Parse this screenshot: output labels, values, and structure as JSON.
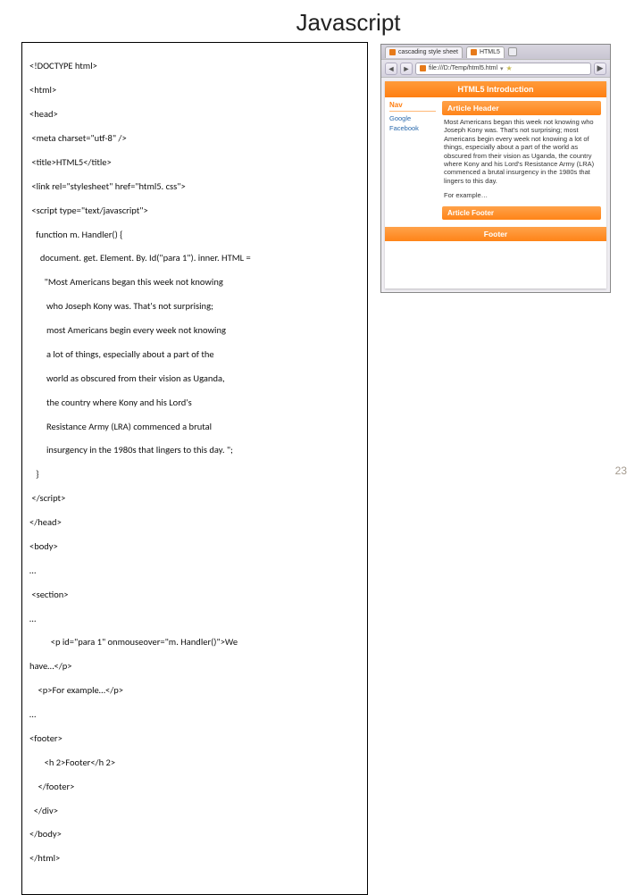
{
  "title": "Javascript",
  "slide_number": "23",
  "code": {
    "l1": "<!DOCTYPE html>",
    "l2": "<html>",
    "l3": "<head>",
    "l4": " <meta charset=\"utf-8\" />",
    "l5": " <title>HTML5</title>",
    "l6": " <link rel=\"stylesheet\" href=\"html5. css\">",
    "l7": " <script type=\"text/javascript\">",
    "l8": "   function m. Handler() {",
    "l9": "     document. get. Element. By. Id(\"para 1\"). inner. HTML =",
    "l10": "       \"Most Americans began this week not knowing",
    "l11": "        who Joseph Kony was. That's not surprising;",
    "l12": "        most Americans begin every week not knowing",
    "l13": "        a lot of things, especially about a part of the",
    "l14": "        world as obscured from their vision as Uganda,",
    "l15": "        the country where Kony and his Lord's",
    "l16": "        Resistance Army (LRA) commenced a brutal",
    "l17": "        insurgency in the 1980s that lingers to this day. \";",
    "l18": "   }",
    "l19": " </script>",
    "l20": "</head>",
    "l21": "<body>",
    "l22": "…",
    "l23": " <section>",
    "l24": "…",
    "l25": "          <p id=\"para 1\" onmouseover=\"m. Handler()\">We",
    "l25b": "have…</p>",
    "l26": "    <p>For example…</p>",
    "l27": "…",
    "l28": "<footer>",
    "l29": "       <h 2>Footer</h 2>",
    "l30": "    </footer>",
    "l31": "  </div>",
    "l32": "</body>",
    "l33": "</html>"
  },
  "browser": {
    "tab1": "cascading style sheet",
    "tab2": "HTML5",
    "url": "file:///D:/Temp/html5.html",
    "page": {
      "banner": "HTML5 Introduction",
      "nav_header": "Nav",
      "nav_links": [
        "Google",
        "Facebook"
      ],
      "article_header": "Article Header",
      "article_body": "Most Americans began this week not knowing who Joseph Kony was. That's not surprising; most Americans begin every week not knowing a lot of things, especially about a part of the world as obscured from their vision as Uganda, the country where Kony and his Lord's Resistance Army (LRA) commenced a brutal insurgency in the 1980s that lingers to this day.",
      "article_body2": "For example…",
      "article_footer": "Article Footer",
      "page_footer": "Footer"
    }
  }
}
